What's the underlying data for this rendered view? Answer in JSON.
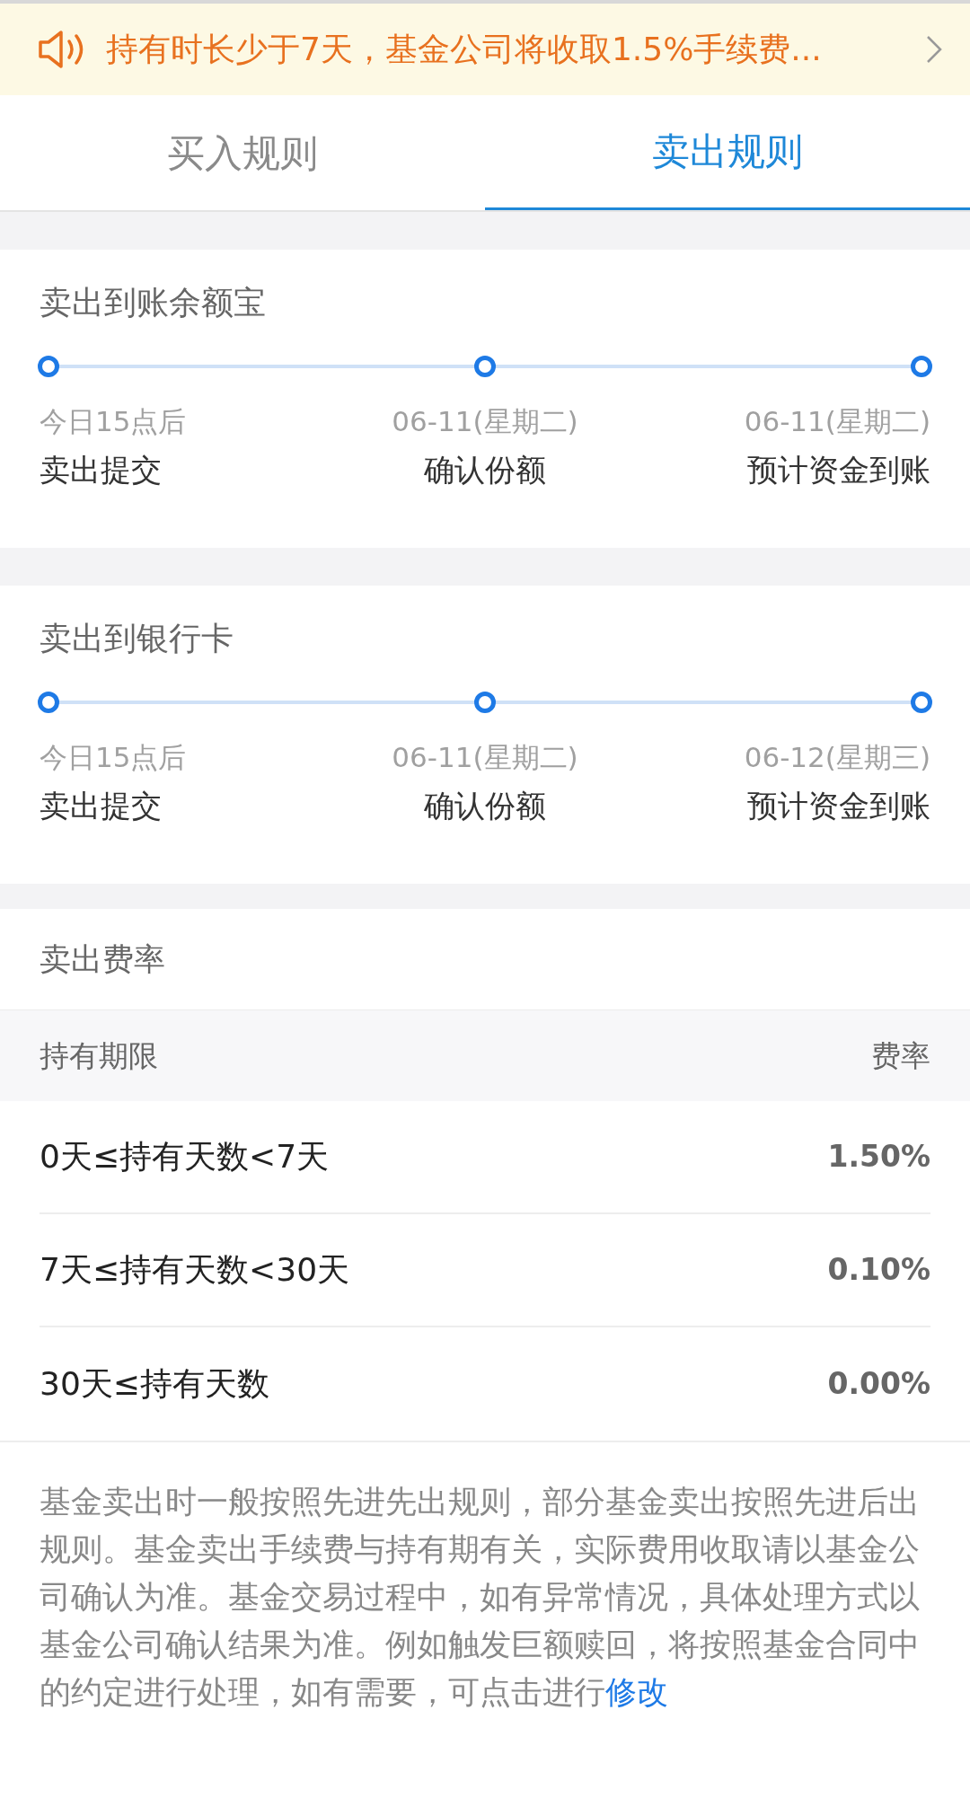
{
  "notice": {
    "text": "持有时长少于7天，基金公司将收取1.5%手续费..."
  },
  "tabs": [
    {
      "label": "买入规则",
      "selected": false
    },
    {
      "label": "卖出规则",
      "selected": true
    }
  ],
  "timelines": [
    {
      "title": "卖出到账余额宝",
      "steps": [
        {
          "date": "今日15点后",
          "label": "卖出提交"
        },
        {
          "date": "06-11(星期二)",
          "label": "确认份额"
        },
        {
          "date": "06-11(星期二)",
          "label": "预计资金到账"
        }
      ]
    },
    {
      "title": "卖出到银行卡",
      "steps": [
        {
          "date": "今日15点后",
          "label": "卖出提交"
        },
        {
          "date": "06-11(星期二)",
          "label": "确认份额"
        },
        {
          "date": "06-12(星期三)",
          "label": "预计资金到账"
        }
      ]
    }
  ],
  "fees": {
    "title": "卖出费率",
    "columns": [
      "持有期限",
      "费率"
    ],
    "rows": [
      {
        "period": "0天≤持有天数<7天",
        "rate": "1.50%"
      },
      {
        "period": "7天≤持有天数<30天",
        "rate": "0.10%"
      },
      {
        "period": "30天≤持有天数",
        "rate": "0.00%"
      }
    ]
  },
  "note": {
    "text": "基金卖出时一般按照先进先出规则，部分基金卖出按照先进后出规则。基金卖出手续费与持有期有关，实际费用收取请以基金公司确认为准。基金交易过程中，如有异常情况，具体处理方式以基金公司确认结果为准。例如触发巨额赎回，将按照基金合同中的约定进行处理，如有需要，可点击进行",
    "link": "修改"
  }
}
